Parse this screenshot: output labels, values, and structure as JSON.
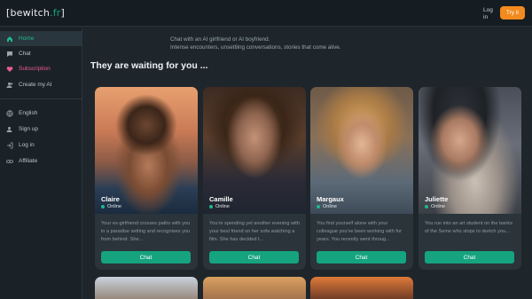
{
  "header": {
    "logo_prefix": "[bewitch",
    "logo_accent": ".fr",
    "logo_suffix": "]",
    "login_label": "Log in",
    "try_label": "Try it"
  },
  "sidebar": {
    "items": [
      {
        "label": "Home",
        "icon": "home-icon"
      },
      {
        "label": "Chat",
        "icon": "chat-icon"
      },
      {
        "label": "Subscription",
        "icon": "heart-icon"
      },
      {
        "label": "Create my AI",
        "icon": "user-plus-icon"
      },
      {
        "label": "English",
        "icon": "globe-icon"
      },
      {
        "label": "Sign up",
        "icon": "user-add-icon"
      },
      {
        "label": "Log in",
        "icon": "login-icon"
      },
      {
        "label": "Affiliate",
        "icon": "link-icon"
      }
    ]
  },
  "hero": {
    "line1": "Chat with an AI girlfriend or AI boyfriend.",
    "line2": "Intense encounters, unsettling conversations, stories that come alive."
  },
  "section_title": "They are waiting for you ...",
  "cards": [
    {
      "name": "Claire",
      "status": "Online",
      "desc": "Your ex-girlfriend crosses paths with you in a paradise setting and recognises you from behind. She...",
      "button": "Chat"
    },
    {
      "name": "Camille",
      "status": "Online",
      "desc": "You're spending yet another evening with your best friend on her sofa watching a film. She has decided t...",
      "button": "Chat"
    },
    {
      "name": "Margaux",
      "status": "Online",
      "desc": "You find yourself alone with your colleague you've been working with for years. You recently went throug...",
      "button": "Chat"
    },
    {
      "name": "Juliette",
      "status": "Online",
      "desc": "You run into an art student on the banks of the Seine who stops to sketch you...",
      "button": "Chat"
    }
  ],
  "colors": {
    "accent": "#16a37f",
    "try": "#f28a1e",
    "subscription": "#ec5b8e"
  }
}
